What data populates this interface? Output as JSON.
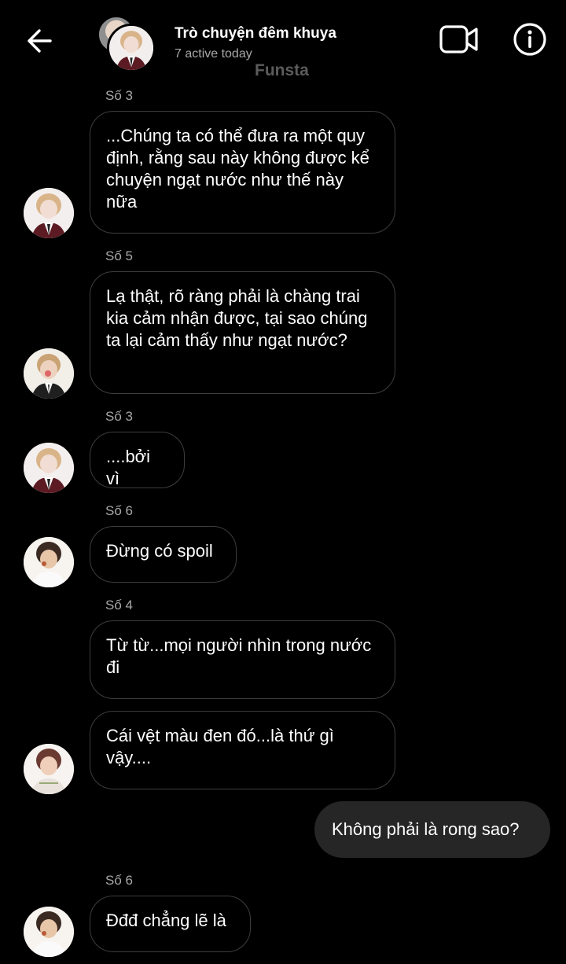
{
  "header": {
    "title": "Trò chuyện đêm khuya",
    "subtitle": "7 active today",
    "watermark": "Funsta",
    "icons": {
      "back": "arrow-left-icon",
      "video": "video-camera-icon",
      "info": "info-icon"
    }
  },
  "messages": [
    {
      "sender": "Số 3",
      "text": "...Chúng ta có thể đưa ra một quy định, rằng sau này không được kể chuyện ngạt nước như thế này nữa"
    },
    {
      "sender": "Số 5",
      "text": "Lạ thật, rõ ràng phải là chàng trai kia cảm nhận được, tại sao chúng ta lại cảm thấy như ngạt nước?"
    },
    {
      "sender": "Số 3",
      "text": "....bởi vì"
    },
    {
      "sender": "Số 6",
      "text": "Đừng có spoil"
    },
    {
      "sender": "Số 4",
      "text": "Từ từ...mọi người nhìn trong nước đi"
    },
    {
      "sender": "",
      "text": "Cái vệt màu đen đó...là thứ gì vậy...."
    },
    {
      "sender": "me",
      "text": "Không phải là rong sao?"
    },
    {
      "sender": "Số 6",
      "text": "Đđđ chẳng lẽ là"
    }
  ],
  "colors": {
    "background": "#000000",
    "bubble_border": "#3d3d3d",
    "own_bubble": "#262626",
    "secondary_text": "#a8a8a8"
  }
}
